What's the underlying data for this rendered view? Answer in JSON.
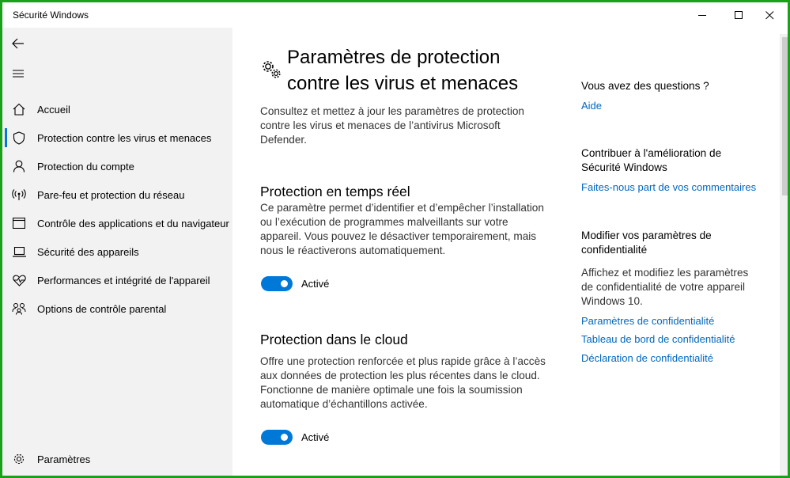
{
  "window": {
    "title": "Sécurité Windows",
    "controls": {
      "minimize": "minimize-icon",
      "maximize": "maximize-icon",
      "close": "close-icon"
    }
  },
  "sidebar": {
    "back_icon": "back-arrow-icon",
    "menu_icon": "hamburger-menu-icon",
    "items": [
      {
        "label": "Accueil",
        "icon": "home-icon",
        "active": false
      },
      {
        "label": "Protection contre les virus et menaces",
        "icon": "shield-icon",
        "active": true
      },
      {
        "label": "Protection du compte",
        "icon": "person-icon",
        "active": false
      },
      {
        "label": "Pare-feu et protection du réseau",
        "icon": "wireless-icon",
        "active": false
      },
      {
        "label": "Contrôle des applications et du navigateur",
        "icon": "browser-window-icon",
        "active": false
      },
      {
        "label": "Sécurité des appareils",
        "icon": "laptop-icon",
        "active": false
      },
      {
        "label": "Performances et intégrité de l'appareil",
        "icon": "heart-pulse-icon",
        "active": false
      },
      {
        "label": "Options de contrôle parental",
        "icon": "family-icon",
        "active": false
      }
    ],
    "settings": {
      "label": "Paramètres",
      "icon": "gear-icon"
    }
  },
  "main": {
    "title_line1": "Paramètres de protection",
    "title_line2": "contre les virus et menaces",
    "title_icon": "gears-icon",
    "intro_line1": "Consultez et mettez à jour les paramètres de protection",
    "intro_line2": "contre les virus et menaces de l’antivirus Microsoft",
    "intro_line3": "Defender.",
    "sections": [
      {
        "title": "Protection en temps réel",
        "desc_lines": [
          "Ce paramètre permet d’identifier et d’empêcher l’installation",
          "ou l’exécution de programmes malveillants sur votre",
          "appareil. Vous pouvez le désactiver temporairement, mais",
          "nous le réactiverons automatiquement."
        ],
        "toggle_on": true,
        "toggle_label": "Activé"
      },
      {
        "title": "Protection dans le cloud",
        "desc_lines": [
          "Offre une protection renforcée et plus rapide grâce à l’accès",
          "aux données de protection les plus récentes dans le cloud.",
          "Fonctionne de manière optimale une fois la soumission",
          "automatique d’échantillons activée."
        ],
        "toggle_on": true,
        "toggle_label": "Activé"
      }
    ]
  },
  "right_column": {
    "questions_heading": "Vous avez des questions ?",
    "help_link": "Aide",
    "contribute_heading_line1": "Contribuer à l'amélioration de",
    "contribute_heading_line2": "Sécurité Windows",
    "feedback_link": "Faites-nous part de vos commentaires",
    "privacy_heading_line1": "Modifier vos paramètres de",
    "privacy_heading_line2": "confidentialité",
    "privacy_text_line1": "Affichez et modifiez les paramètres",
    "privacy_text_line2": "de confidentialité de votre appareil",
    "privacy_text_line3": "Windows 10.",
    "privacy_links": [
      "Paramètres de confidentialité",
      "Tableau de bord de confidentialité",
      "Déclaration de confidentialité"
    ]
  },
  "colors": {
    "accent": "#0078d7",
    "link": "#0067c0",
    "sidebar_bg": "#f2f2f2",
    "border": "#1aa11a"
  }
}
